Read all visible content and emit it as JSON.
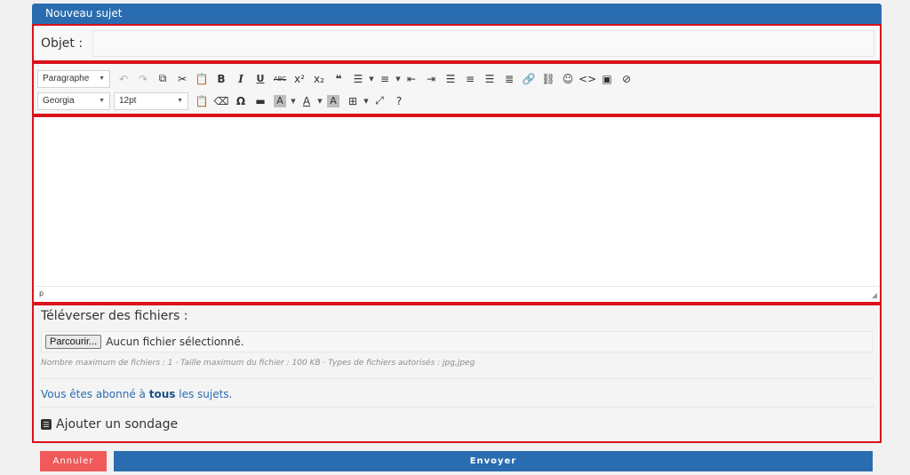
{
  "header": {
    "title": "Nouveau sujet"
  },
  "subject": {
    "label": "Objet :",
    "value": ""
  },
  "toolbar": {
    "format_select": "Paragraphe",
    "font_select": "Georgia",
    "size_select": "12pt"
  },
  "editor": {
    "path": "p"
  },
  "upload": {
    "title": "Téléverser des fichiers :",
    "browse_label": "Parcourir...",
    "no_file": "Aucun fichier sélectionné.",
    "info": "Nombre maximum de fichiers : 1 · Taille maximum du fichier : 100 KB · Types de fichiers autorisés : jpg,jpeg"
  },
  "subscription": {
    "prefix": "Vous êtes abonné à",
    "bold": "tous",
    "suffix": "les sujets."
  },
  "poll": {
    "label": "Ajouter un sondage"
  },
  "actions": {
    "cancel": "Annuler",
    "send": "Envoyer"
  }
}
